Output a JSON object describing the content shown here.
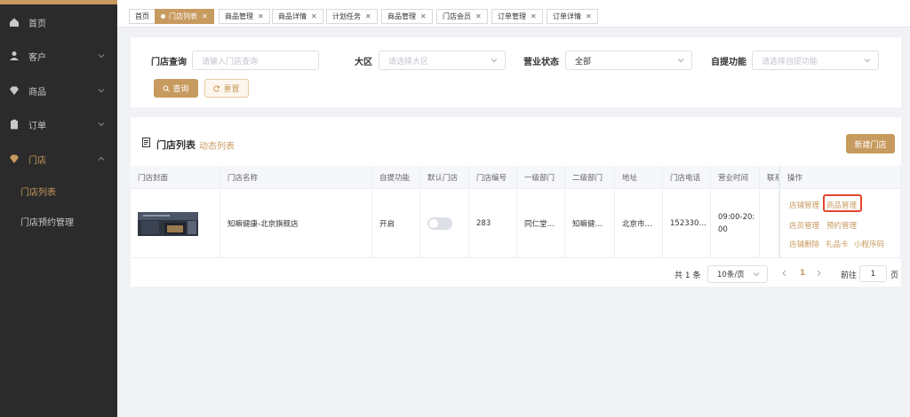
{
  "sidebar": {
    "items": [
      {
        "label": "首页",
        "icon": "home-icon"
      },
      {
        "label": "客户",
        "icon": "user-icon"
      },
      {
        "label": "商品",
        "icon": "diamond-icon"
      },
      {
        "label": "订单",
        "icon": "clipboard-icon"
      },
      {
        "label": "门店",
        "icon": "diamond-icon"
      }
    ],
    "subitems": [
      {
        "label": "门店列表"
      },
      {
        "label": "门店预约管理"
      }
    ]
  },
  "tabs": [
    {
      "label": "首页"
    },
    {
      "label": "门店列表"
    },
    {
      "label": "商品管理"
    },
    {
      "label": "商品详情"
    },
    {
      "label": "计划任务"
    },
    {
      "label": "商品管理"
    },
    {
      "label": "门店会员"
    },
    {
      "label": "订单管理"
    },
    {
      "label": "订单详情"
    }
  ],
  "filters": {
    "store_query_label": "门店查询",
    "store_query_placeholder": "请输入门店查询",
    "region_label": "大区",
    "region_placeholder": "请选择大区",
    "status_label": "营业状态",
    "status_value": "全部",
    "pickup_label": "自提功能",
    "pickup_placeholder": "请选择自提功能",
    "search_button": "查询",
    "reset_button": "重置"
  },
  "list": {
    "title": "门店列表",
    "subtitle": "动态列表",
    "new_button": "新建门店",
    "columns": [
      "门店封面",
      "门店名称",
      "自提功能",
      "默认门店",
      "门店编号",
      "一级部门",
      "二级部门",
      "地址",
      "门店电话",
      "营业时间",
      "联系",
      "操作"
    ],
    "row": {
      "name": "知嘛健康-北京旗舰店",
      "pickup": "开启",
      "store_no": "283",
      "dept1": "同仁堂…",
      "dept2": "知嘛健…",
      "address": "北京市…",
      "phone": "152330…",
      "hours": "09:00-20:00"
    },
    "operations": [
      "店铺管理",
      "商品管理",
      "店员管理",
      "预约管理",
      "店铺删除",
      "礼品卡",
      "小程序码"
    ]
  },
  "pagination": {
    "total": "共 1 条",
    "page_size": "10条/页",
    "current_page": "1",
    "goto_label": "前往",
    "goto_value": "1",
    "page_suffix": "页"
  },
  "colors": {
    "accent": "#c79a5f",
    "sidebar": "#2b2b2b",
    "highlight_border": "#e5452f"
  }
}
